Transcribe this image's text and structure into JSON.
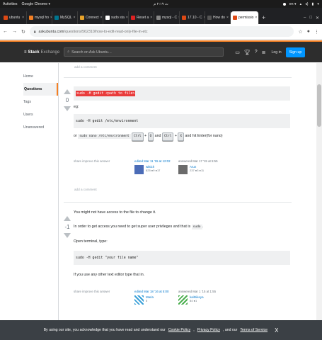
{
  "topbar": {
    "activities": "Activities",
    "app": "Google Chrome ▾",
    "clock": "ث ٢:١٩ م",
    "lang": "en ▾"
  },
  "tabs": [
    {
      "label": "ubuntu",
      "color": "#dd4814"
    },
    {
      "label": "mysql ho",
      "color": "#f48024"
    },
    {
      "label": "MySQL",
      "color": "#00758f"
    },
    {
      "label": "Connect",
      "color": "#e8a32a"
    },
    {
      "label": "sudo sta",
      "color": "#ffffff"
    },
    {
      "label": "Reset a",
      "color": "#d22"
    },
    {
      "label": "mysql - C",
      "color": "#888"
    },
    {
      "label": "17.10 - C",
      "color": "#dd4814"
    },
    {
      "label": "How do",
      "color": "#555"
    },
    {
      "label": "permissio",
      "color": "#dd4814",
      "active": true
    }
  ],
  "address": {
    "host": "askubuntu.com",
    "path": "/questions/562310/how-to-edit-read-only-file-in-etc"
  },
  "site": {
    "logo_a": "Stack",
    "logo_b": "Exchange",
    "search_placeholder": "Search on Ask Ubuntu…",
    "login": "Log in",
    "signup": "Sign up"
  },
  "leftnav": {
    "home": "Home",
    "questions": "Questions",
    "tags": "Tags",
    "users": "Users",
    "unanswered": "Unanswered"
  },
  "add_comment": "add a comment",
  "answer1": {
    "score": "0",
    "code1": "sudo -H gedit <path to file>",
    "eg": "eg:",
    "code2": "sudo -H gedit /etc/environment",
    "or": "or",
    "inline": "sudo nano /etc/environment",
    "k1": "Ctrl",
    "plus": "+",
    "k2": "O",
    "and": "and",
    "k3": "Ctrl",
    "k4": "X",
    "tail": "and hit Enter(for nano)",
    "share": "share  improve this answer",
    "edited": "edited Mar 11 '15 at 12:02",
    "editor": "wittich",
    "editor_rep": "825  ●9 ●17",
    "answered": "answered Mar 17 '15 at 5:55",
    "author": "Arun",
    "author_rep": "237  ●3 ●11"
  },
  "answer2": {
    "score": "-1",
    "p1": "You might not have access to the file to change it.",
    "p2a": "In order to get access you need to get super user privileges and that is",
    "p2code": "sudo",
    "p2b": ".",
    "p3": "Open terminal, type:",
    "code": "sudo -H gedit \"your file name\"",
    "p4": "If you use any other text editor type that in.",
    "share": "share  improve this answer",
    "edited": "edited Mar 18 '16 at 5:00",
    "editor": "Maria",
    "editor_rep": "5",
    "answered": "answered Mar 1 '15 at 1:55",
    "author": "kaithikeya",
    "author_rep": "84 ●1"
  },
  "cookie": {
    "text": "By using our site, you acknowledge that you have read and understand our",
    "cp": "Cookie Policy",
    "pp": "Privacy Policy",
    "and": ", and our",
    "tos": "Terms of Service",
    "close": "X"
  }
}
